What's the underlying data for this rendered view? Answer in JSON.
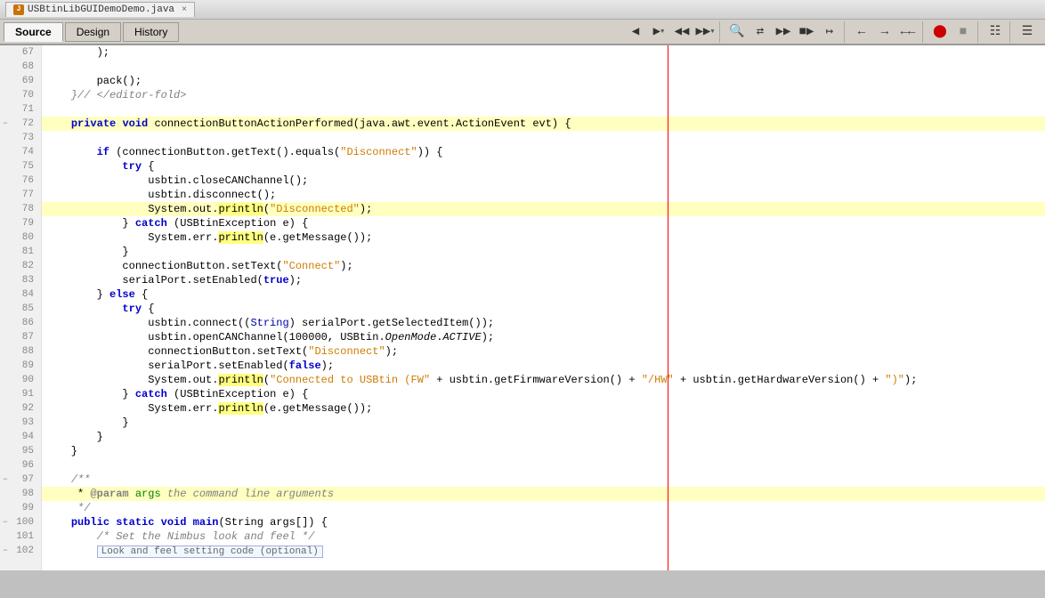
{
  "titlebar": {
    "filename": "USBtinLibGUIDemoDemo.java",
    "close_label": "×"
  },
  "tabs": {
    "source_label": "Source",
    "design_label": "Design",
    "history_label": "History",
    "active": "source"
  },
  "toolbar": {
    "icons": [
      "back",
      "forward",
      "back2",
      "forward2",
      "separator",
      "toggle1",
      "toggle2",
      "separator2",
      "go-back",
      "go-forward",
      "go-back2",
      "go-forward2",
      "separator3",
      "open-book",
      "separator4",
      "stop",
      "stop2",
      "separator5",
      "grid",
      "separator6",
      "flag"
    ]
  },
  "code": {
    "lines": [
      {
        "num": 67,
        "indent": 3,
        "fold": "",
        "content": "        );",
        "highlight": false,
        "tokens": [
          {
            "text": "        );",
            "type": "plain"
          }
        ]
      },
      {
        "num": 68,
        "indent": 0,
        "fold": "",
        "content": "",
        "highlight": false,
        "tokens": []
      },
      {
        "num": 69,
        "indent": 2,
        "fold": "",
        "content": "        pack();",
        "highlight": false,
        "tokens": [
          {
            "text": "        pack();",
            "type": "plain"
          }
        ]
      },
      {
        "num": 70,
        "indent": 2,
        "fold": "",
        "content": "    }// </editor-fold>",
        "highlight": false,
        "tokens": [
          {
            "text": "    }// </editor-fold>",
            "type": "cm"
          }
        ]
      },
      {
        "num": 71,
        "indent": 0,
        "fold": "",
        "content": "",
        "highlight": false,
        "tokens": []
      },
      {
        "num": 72,
        "indent": 1,
        "fold": "collapse",
        "content": "    private void connectionButtonActionPerformed(java.awt.event.ActionEvent evt) {",
        "highlight": true,
        "tokens": [
          {
            "text": "    "
          },
          {
            "text": "private",
            "type": "kw"
          },
          {
            "text": " "
          },
          {
            "text": "void",
            "type": "kw"
          },
          {
            "text": " connectionButtonActionPerformed(java.awt.event.ActionEvent evt) {"
          }
        ]
      },
      {
        "num": 73,
        "indent": 0,
        "fold": "",
        "content": "",
        "highlight": false,
        "tokens": []
      },
      {
        "num": 74,
        "indent": 3,
        "fold": "",
        "content": "        if (connectionButton.getText().equals(\"Disconnect\")) {",
        "highlight": false,
        "tokens": [
          {
            "text": "        "
          },
          {
            "text": "if",
            "type": "kw"
          },
          {
            "text": " (connectionButton.getText().equals("
          },
          {
            "text": "\"Disconnect\"",
            "type": "str"
          },
          {
            "text": ")) {"
          }
        ]
      },
      {
        "num": 75,
        "indent": 4,
        "fold": "",
        "content": "            try {",
        "highlight": false,
        "tokens": [
          {
            "text": "            "
          },
          {
            "text": "try",
            "type": "kw"
          },
          {
            "text": " {"
          }
        ]
      },
      {
        "num": 76,
        "indent": 5,
        "fold": "",
        "content": "                usbtin.closeCANChannel();",
        "highlight": false,
        "tokens": [
          {
            "text": "                usbtin.closeCANChannel();"
          }
        ]
      },
      {
        "num": 77,
        "indent": 5,
        "fold": "",
        "content": "                usbtin.disconnect();",
        "highlight": false,
        "tokens": [
          {
            "text": "                usbtin.disconnect();"
          }
        ]
      },
      {
        "num": 78,
        "indent": 5,
        "fold": "",
        "content": "                System.out.println(\"Disconnected\");",
        "highlight": true,
        "tokens": [
          {
            "text": "                System.out."
          },
          {
            "text": "println",
            "type": "highlight_method"
          },
          {
            "text": "("
          },
          {
            "text": "\"Disconnected\"",
            "type": "str"
          },
          {
            "text": ");"
          }
        ]
      },
      {
        "num": 79,
        "indent": 4,
        "fold": "",
        "content": "            } catch (USBtinException e) {",
        "highlight": false,
        "tokens": [
          {
            "text": "            } "
          },
          {
            "text": "catch",
            "type": "kw"
          },
          {
            "text": " (USBtinException e) {"
          }
        ]
      },
      {
        "num": 80,
        "indent": 5,
        "fold": "",
        "content": "                System.err.println(e.getMessage());",
        "highlight": false,
        "tokens": [
          {
            "text": "                System.err."
          },
          {
            "text": "println",
            "type": "highlight_method2"
          },
          {
            "text": "(e.getMessage());"
          }
        ]
      },
      {
        "num": 81,
        "indent": 4,
        "fold": "",
        "content": "            }",
        "highlight": false,
        "tokens": [
          {
            "text": "            }"
          }
        ]
      },
      {
        "num": 82,
        "indent": 3,
        "fold": "",
        "content": "            connectionButton.setText(\"Connect\");",
        "highlight": false,
        "tokens": [
          {
            "text": "            connectionButton.setText("
          },
          {
            "text": "\"Connect\"",
            "type": "str"
          },
          {
            "text": ");"
          }
        ]
      },
      {
        "num": 83,
        "indent": 3,
        "fold": "",
        "content": "            serialPort.setEnabled(true);",
        "highlight": false,
        "tokens": [
          {
            "text": "            serialPort.setEnabled("
          },
          {
            "text": "true",
            "type": "kw"
          },
          {
            "text": ");"
          }
        ]
      },
      {
        "num": 84,
        "indent": 3,
        "fold": "",
        "content": "        } else {",
        "highlight": false,
        "tokens": [
          {
            "text": "        } "
          },
          {
            "text": "else",
            "type": "kw"
          },
          {
            "text": " {"
          }
        ]
      },
      {
        "num": 85,
        "indent": 4,
        "fold": "",
        "content": "            try {",
        "highlight": false,
        "tokens": [
          {
            "text": "            "
          },
          {
            "text": "try",
            "type": "kw"
          },
          {
            "text": " {"
          }
        ]
      },
      {
        "num": 86,
        "indent": 5,
        "fold": "",
        "content": "                usbtin.connect((String) serialPort.getSelectedItem());",
        "highlight": false,
        "tokens": [
          {
            "text": "                usbtin.connect(("
          },
          {
            "text": "String",
            "type": "type"
          },
          {
            "text": ") serialPort.getSelectedItem());"
          }
        ]
      },
      {
        "num": 87,
        "indent": 5,
        "fold": "",
        "content": "                usbtin.openCANChannel(100000, USBtin.OpenMode.ACTIVE);",
        "highlight": false,
        "tokens": [
          {
            "text": "                usbtin.openCANChannel(100000, USBtin."
          },
          {
            "text": "OpenMode",
            "type": "italic_method"
          },
          {
            "text": "."
          },
          {
            "text": "ACTIVE",
            "type": "italic_method"
          },
          {
            "text": ");"
          }
        ]
      },
      {
        "num": 88,
        "indent": 5,
        "fold": "",
        "content": "                connectionButton.setText(\"Disconnect\");",
        "highlight": false,
        "tokens": [
          {
            "text": "                connectionButton.setText("
          },
          {
            "text": "\"Disconnect\"",
            "type": "str"
          },
          {
            "text": ");"
          }
        ]
      },
      {
        "num": 89,
        "indent": 5,
        "fold": "",
        "content": "                serialPort.setEnabled(false);",
        "highlight": false,
        "tokens": [
          {
            "text": "                serialPort.setEnabled("
          },
          {
            "text": "false",
            "type": "kw"
          },
          {
            "text": ");"
          }
        ]
      },
      {
        "num": 90,
        "indent": 5,
        "fold": "",
        "content": "                System.out.println(\"Connected to USBtin (FW\" + usbtin.getFirmwareVersion() + \"/HW\" + usbtin.getHardwareVersion() + \")\");",
        "highlight": false,
        "tokens": [
          {
            "text": "                System.out."
          },
          {
            "text": "println",
            "type": "highlight_method"
          },
          {
            "text": "("
          },
          {
            "text": "\"Connected to USBtin (FW\"",
            "type": "str"
          },
          {
            "text": " + usbtin.getFirmwareVersion() + "
          },
          {
            "text": "\"/HW\"",
            "type": "str"
          },
          {
            "text": " + usbtin.getHardwareVersion() + "
          },
          {
            "text": "\")\"",
            "type": "str"
          },
          {
            "text": ");"
          }
        ]
      },
      {
        "num": 91,
        "indent": 4,
        "fold": "",
        "content": "            } catch (USBtinException e) {",
        "highlight": false,
        "tokens": [
          {
            "text": "            } "
          },
          {
            "text": "catch",
            "type": "kw"
          },
          {
            "text": " (USBtinException e) {"
          }
        ]
      },
      {
        "num": 92,
        "indent": 5,
        "fold": "",
        "content": "                System.err.println(e.getMessage());",
        "highlight": false,
        "tokens": [
          {
            "text": "                System.err."
          },
          {
            "text": "println",
            "type": "highlight_method2"
          },
          {
            "text": "(e.getMessage());"
          }
        ]
      },
      {
        "num": 93,
        "indent": 4,
        "fold": "",
        "content": "            }",
        "highlight": false,
        "tokens": [
          {
            "text": "            }"
          }
        ]
      },
      {
        "num": 94,
        "indent": 3,
        "fold": "",
        "content": "        }",
        "highlight": false,
        "tokens": [
          {
            "text": "        }"
          }
        ]
      },
      {
        "num": 95,
        "indent": 2,
        "fold": "",
        "content": "    }",
        "highlight": false,
        "tokens": [
          {
            "text": "    }"
          }
        ]
      },
      {
        "num": 96,
        "indent": 0,
        "fold": "",
        "content": "",
        "highlight": false,
        "tokens": []
      },
      {
        "num": 97,
        "indent": 1,
        "fold": "collapse",
        "content": "    /**",
        "highlight": false,
        "tokens": [
          {
            "text": "    "
          },
          {
            "text": "/**",
            "type": "cm"
          }
        ]
      },
      {
        "num": 98,
        "indent": 2,
        "fold": "",
        "content": "     * @param args the command line arguments",
        "highlight": true,
        "tokens": [
          {
            "text": "     * "
          },
          {
            "text": "@param",
            "type": "cm_tag"
          },
          {
            "text": " "
          },
          {
            "text": "args",
            "type": "cm_param"
          },
          {
            "text": " "
          },
          {
            "text": "the command line arguments",
            "type": "cm"
          }
        ]
      },
      {
        "num": 99,
        "indent": 2,
        "fold": "",
        "content": "     */",
        "highlight": false,
        "tokens": [
          {
            "text": "     */",
            "type": "cm"
          }
        ]
      },
      {
        "num": 100,
        "indent": 1,
        "fold": "collapse",
        "content": "    public static void main(String args[]) {",
        "highlight": false,
        "tokens": [
          {
            "text": "    "
          },
          {
            "text": "public",
            "type": "kw"
          },
          {
            "text": " "
          },
          {
            "text": "static",
            "type": "kw"
          },
          {
            "text": " "
          },
          {
            "text": "void",
            "type": "kw"
          },
          {
            "text": " "
          },
          {
            "text": "main",
            "type": "kw2"
          },
          {
            "text": "(String args[]) {"
          }
        ]
      },
      {
        "num": 101,
        "indent": 3,
        "fold": "",
        "content": "        /* Set the Nimbus look and feel */",
        "highlight": false,
        "tokens": [
          {
            "text": "        "
          },
          {
            "text": "/* Set the Nimbus look and feel */",
            "type": "cm"
          }
        ]
      },
      {
        "num": 102,
        "indent": 3,
        "fold": "collapse",
        "content": "        Look and feel setting code (optional)",
        "highlight": false,
        "collapsed": true,
        "tokens": [
          {
            "text": "        "
          },
          {
            "text": "Look and feel setting code (optional)",
            "type": "collapsed"
          }
        ]
      }
    ]
  }
}
